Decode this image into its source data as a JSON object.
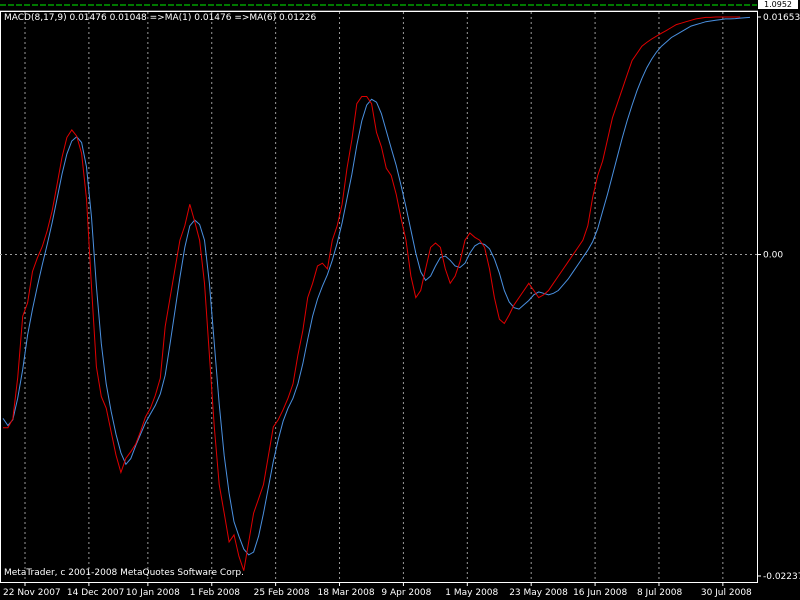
{
  "indicator": {
    "label": "MACD(8,17,9) 0.01476 0.01048  =>MA(1) 0.01476  =>MA(6) 0.01226"
  },
  "top_panel": {
    "price_label": "1.0952"
  },
  "copyright": "MetaTrader, c 2001-2008 MetaQuotes Software Corp.",
  "colors": {
    "background": "#000000",
    "grid": "#9a9a9a",
    "zero_line": "#9a9a9a",
    "macd_line": "#e00000",
    "signal_line": "#4a90e0",
    "top_strip": "#00c000",
    "axis": "#ffffff"
  },
  "chart_data": {
    "type": "line",
    "y_axis_labels": [
      "0.01653",
      "0.00",
      "-0.02237"
    ],
    "ylim": [
      -0.02237,
      0.01653
    ],
    "x_tick_labels": [
      "22 Nov 2007",
      "14 Dec 2007",
      "10 Jan 2008",
      "1 Feb 2008",
      "25 Feb 2008",
      "18 Mar 2008",
      "9 Apr 2008",
      "1 May 2008",
      "23 May 2008",
      "16 Jun 2008",
      "8 Jul 2008",
      "30 Jul 2008"
    ],
    "x_tick_index": [
      0,
      13,
      25,
      38,
      51,
      64,
      77,
      90,
      103,
      116,
      129,
      142
    ],
    "n_points": 153,
    "grid": "vertical dotted",
    "series": [
      {
        "name": "MA(1)",
        "color": "#e00000",
        "values": [
          -0.01205,
          -0.01205,
          -0.01144,
          -0.00858,
          -0.00429,
          -0.00336,
          -0.00118,
          -0.00023,
          0.00056,
          0.00165,
          0.00302,
          0.00488,
          0.00677,
          0.00815,
          0.00867,
          0.00824,
          0.00704,
          0.00387,
          -0.00224,
          -0.00781,
          -0.00988,
          -0.01069,
          -0.01233,
          -0.01396,
          -0.01517,
          -0.01417,
          -0.01372,
          -0.0132,
          -0.0123,
          -0.0113,
          -0.0107,
          -0.0098,
          -0.0086,
          -0.005,
          -0.003,
          -0.001,
          0.001,
          0.002,
          0.0035,
          0.0023,
          0.001,
          -0.002,
          -0.007,
          -0.012,
          -0.016,
          -0.018,
          -0.02,
          -0.0195,
          -0.021,
          -0.022,
          -0.02,
          -0.018,
          -0.017,
          -0.016,
          -0.014,
          -0.012,
          -0.0115,
          -0.0108,
          -0.01,
          -0.009,
          -0.007,
          -0.0053,
          -0.003,
          -0.002,
          -0.0008,
          -0.0006,
          -0.001,
          0.001,
          0.002,
          0.0035,
          0.006,
          0.008,
          0.0105,
          0.011,
          0.011,
          0.0105,
          0.0085,
          0.0075,
          0.006,
          0.0055,
          0.0042,
          0.0025,
          0.001,
          -0.0015,
          -0.003,
          -0.0025,
          -0.001,
          0.0005,
          0.0008,
          0.0005,
          -0.001,
          -0.002,
          -0.0015,
          -0.0005,
          0.001,
          0.0015,
          0.0012,
          0.001,
          0.0005,
          -0.001,
          -0.003,
          -0.0045,
          -0.0048,
          -0.0042,
          -0.0035,
          -0.003,
          -0.0025,
          -0.002,
          -0.0025,
          -0.003,
          -0.0028,
          -0.0025,
          -0.002,
          -0.0015,
          -0.001,
          -0.0005,
          0.0,
          0.0005,
          0.001,
          0.002,
          0.004,
          0.0055,
          0.0065,
          0.008,
          0.0095,
          0.0105,
          0.0115,
          0.0125,
          0.0135,
          0.014,
          0.0145,
          0.01476,
          0.015,
          0.0152,
          0.0154,
          0.0156,
          0.0158,
          0.016,
          0.0161,
          0.0162,
          0.0163,
          0.0164,
          0.01645,
          0.0165,
          0.0165,
          0.01653,
          0.01653,
          0.01653,
          0.01653,
          0.01653,
          0.01653
        ]
      },
      {
        "name": "MA(6)",
        "color": "#4a90e0",
        "values": [
          -0.0114,
          -0.0119,
          -0.0115,
          -0.01,
          -0.008,
          -0.0056,
          -0.0038,
          -0.0022,
          -0.0007,
          0.0007,
          0.0022,
          0.0039,
          0.0056,
          0.007,
          0.0079,
          0.0082,
          0.0078,
          0.0061,
          0.0026,
          -0.0022,
          -0.0062,
          -0.009,
          -0.0109,
          -0.0125,
          -0.0138,
          -0.0146,
          -0.0142,
          -0.0133,
          -0.0125,
          -0.0117,
          -0.0111,
          -0.0105,
          -0.0097,
          -0.0084,
          -0.0062,
          -0.0039,
          -0.0016,
          0.0005,
          0.002,
          0.0024,
          0.0021,
          0.001,
          -0.002,
          -0.0062,
          -0.0104,
          -0.014,
          -0.0166,
          -0.0186,
          -0.0196,
          -0.0205,
          -0.0209,
          -0.0207,
          -0.0196,
          -0.018,
          -0.0162,
          -0.0144,
          -0.0129,
          -0.0116,
          -0.0107,
          -0.01,
          -0.009,
          -0.0076,
          -0.0059,
          -0.0043,
          -0.0031,
          -0.0022,
          -0.0014,
          -0.0004,
          0.0008,
          0.0022,
          0.0039,
          0.0056,
          0.0076,
          0.0093,
          0.0104,
          0.0108,
          0.0106,
          0.0098,
          0.0086,
          0.0074,
          0.0062,
          0.0048,
          0.0033,
          0.0017,
          0.0001,
          -0.0012,
          -0.0018,
          -0.0015,
          -0.0008,
          -0.0002,
          -0.0001,
          -0.0004,
          -0.0008,
          -0.0009,
          -0.0006,
          0.0001,
          0.0006,
          0.0008,
          0.0007,
          0.0004,
          -0.0003,
          -0.0013,
          -0.0025,
          -0.0033,
          -0.0037,
          -0.0038,
          -0.0035,
          -0.0032,
          -0.0028,
          -0.0026,
          -0.0027,
          -0.0028,
          -0.0027,
          -0.0025,
          -0.0021,
          -0.0017,
          -0.0012,
          -0.0007,
          -0.0002,
          0.0003,
          0.0009,
          0.0018,
          0.003,
          0.0042,
          0.0055,
          0.0068,
          0.0081,
          0.0093,
          0.0104,
          0.0114,
          0.01226,
          0.013,
          0.0136,
          0.0141,
          0.0145,
          0.0148,
          0.0151,
          0.0153,
          0.0155,
          0.0157,
          0.0159,
          0.016,
          0.0161,
          0.0162,
          0.01625,
          0.0163,
          0.01635,
          0.0164,
          0.0164,
          0.01642,
          0.01645,
          0.01648,
          0.0165
        ]
      }
    ]
  }
}
